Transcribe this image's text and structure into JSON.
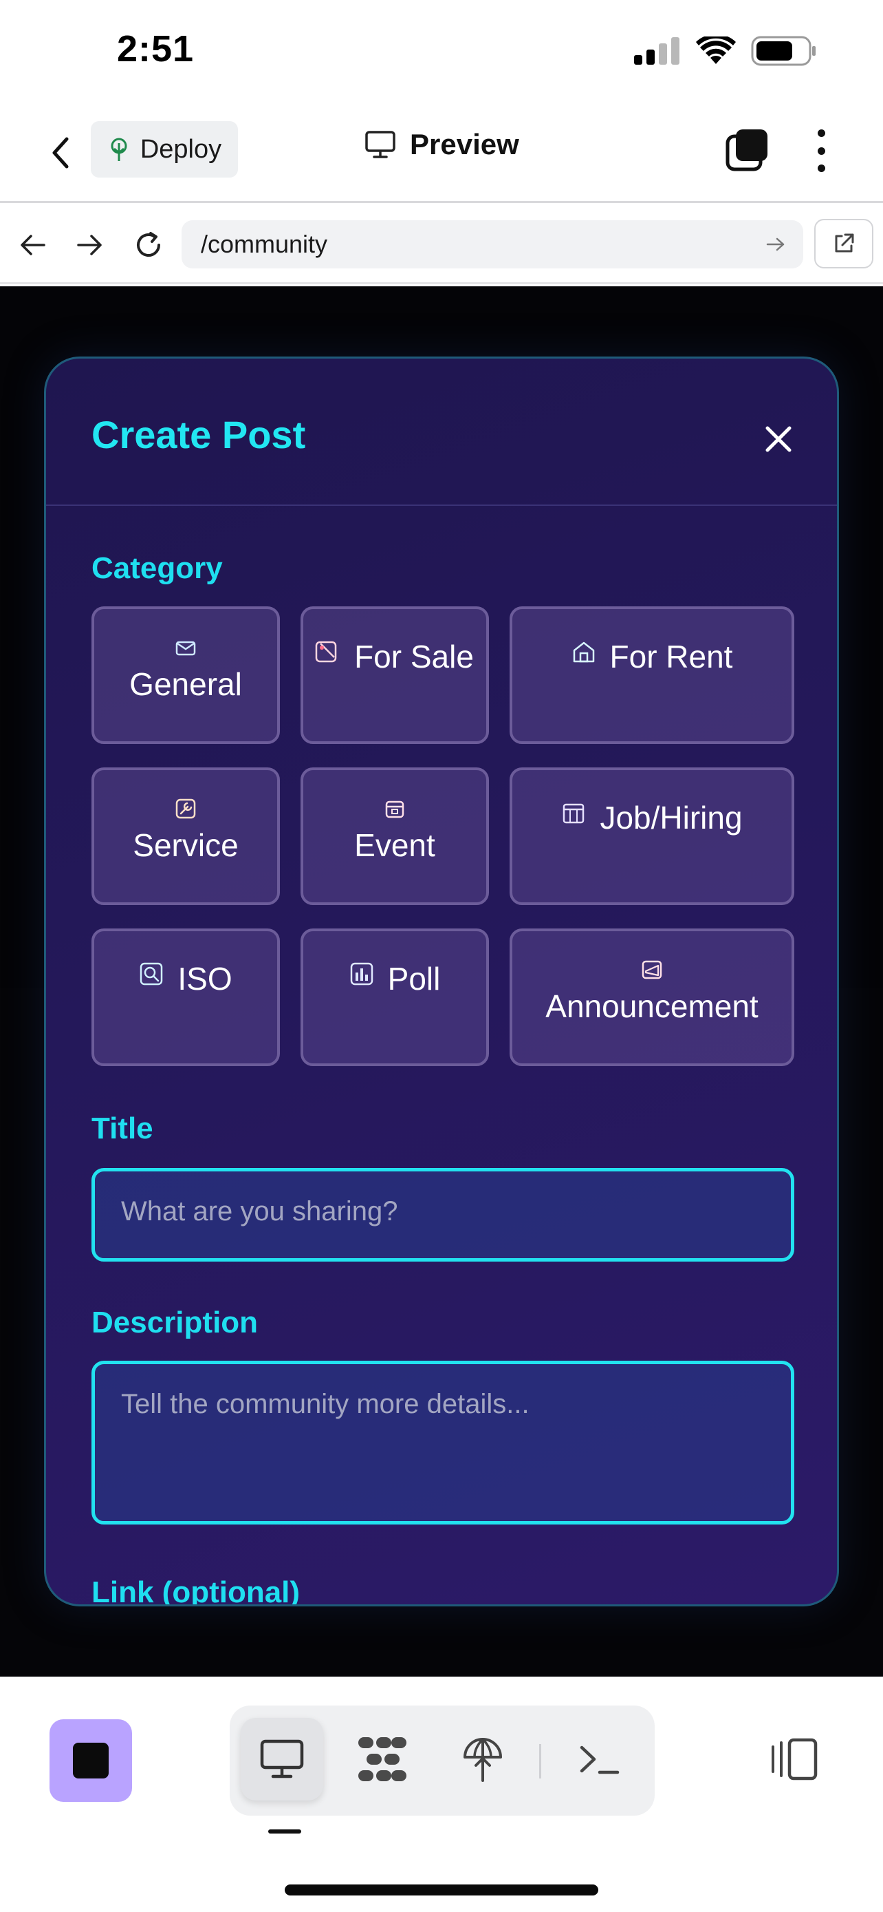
{
  "status_bar": {
    "time": "2:51"
  },
  "header": {
    "deploy_label": "Deploy",
    "title": "Preview"
  },
  "browser": {
    "url": "/community"
  },
  "modal": {
    "title": "Create Post",
    "category_label": "Category",
    "categories": [
      {
        "label": "General",
        "icon": "envelope-icon"
      },
      {
        "label": "For Sale",
        "icon": "tag-icon"
      },
      {
        "label": "For Rent",
        "icon": "house-icon"
      },
      {
        "label": "Service",
        "icon": "wrench-icon"
      },
      {
        "label": "Event",
        "icon": "calendar-icon"
      },
      {
        "label": "Job/Hiring",
        "icon": "building-icon"
      },
      {
        "label": "ISO",
        "icon": "magnifier-icon"
      },
      {
        "label": "Poll",
        "icon": "bar-chart-icon"
      },
      {
        "label": "Announcement",
        "icon": "megaphone-icon"
      }
    ],
    "title_label": "Title",
    "title_placeholder": "What are you sharing?",
    "description_label": "Description",
    "description_placeholder": "Tell the community more details...",
    "link_label": "Link (optional)"
  },
  "colors": {
    "accent": "#22e6f2",
    "modal_bg": "#24185a",
    "stop_button": "#b9a3ff"
  }
}
